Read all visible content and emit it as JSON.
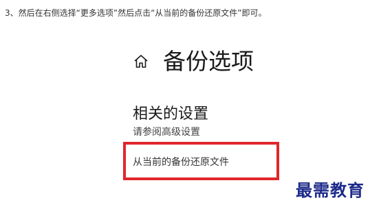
{
  "instruction": "3、然后在右侧选择“更多选项”然后点击“从当前的备份还原文件”即可。",
  "header": {
    "icon": "home-icon",
    "title": "备份选项"
  },
  "related_settings": {
    "title": "相关的设置",
    "advanced_link": "请参阅高级设置"
  },
  "restore_link": "从当前的备份还原文件",
  "highlight_color": "#e0262b",
  "watermark": "最需教育",
  "watermark_color": "#1c2a8a"
}
